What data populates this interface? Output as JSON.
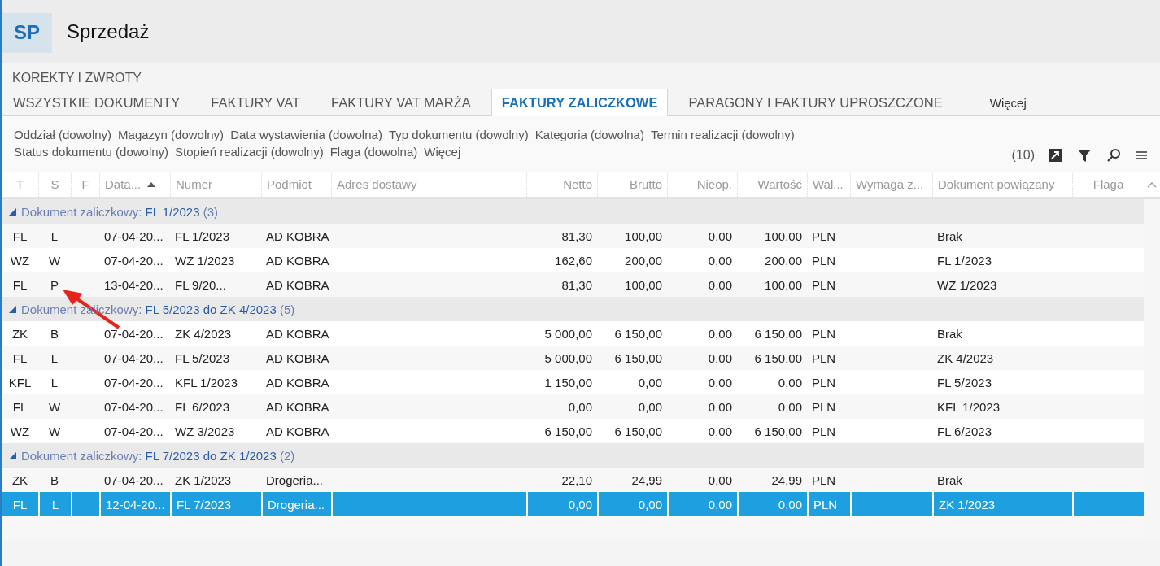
{
  "app": {
    "badge": "SP",
    "title": "Sprzedaż"
  },
  "section": "KOREKTY I ZWROTY",
  "tabs": [
    {
      "label": "WSZYSTKIE DOKUMENTY",
      "selected": false
    },
    {
      "label": "FAKTURY VAT",
      "selected": false
    },
    {
      "label": "FAKTURY VAT MARŻA",
      "selected": false
    },
    {
      "label": "FAKTURY ZALICZKOWE",
      "selected": true
    },
    {
      "label": "PARAGONY I FAKTURY UPROSZCZONE",
      "selected": false
    },
    {
      "label": "Więcej",
      "selected": false
    }
  ],
  "filters": [
    [
      "Oddział (dowolny)",
      "Magazyn (dowolny)",
      "Data wystawienia (dowolna)",
      "Typ dokumentu (dowolny)",
      "Kategoria (dowolna)",
      "Termin realizacji (dowolny)"
    ],
    [
      "Status dokumentu (dowolny)",
      "Stopień realizacji (dowolny)",
      "Flaga (dowolna)",
      "Więcej"
    ]
  ],
  "count": "(10)",
  "table": {
    "columns": [
      {
        "label": "T"
      },
      {
        "label": "S"
      },
      {
        "label": "F"
      },
      {
        "label": "Data...",
        "sorted": true
      },
      {
        "label": "Numer"
      },
      {
        "label": "Podmiot"
      },
      {
        "label": "Adres dostawy"
      },
      {
        "label": "Netto"
      },
      {
        "label": "Brutto"
      },
      {
        "label": "Nieop."
      },
      {
        "label": "Wartość"
      },
      {
        "label": "Wal..."
      },
      {
        "label": "Wymaga z..."
      },
      {
        "label": "Dokument powiązany"
      },
      {
        "label": "Flaga"
      }
    ],
    "groups": [
      {
        "label": "Dokument zaliczkowy:",
        "value": "FL 1/2023",
        "count": "(3)",
        "expanded": true,
        "rows": [
          {
            "cells": [
              "FL",
              "L",
              "",
              "07-04-20...",
              "FL 1/2023",
              "AD KOBRA",
              "",
              "81,30",
              "100,00",
              "0,00",
              "100,00",
              "PLN",
              "",
              "Brak",
              ""
            ],
            "selected": false
          },
          {
            "cells": [
              "WZ",
              "W",
              "",
              "07-04-20...",
              "WZ 1/2023",
              "AD KOBRA",
              "",
              "162,60",
              "200,00",
              "0,00",
              "200,00",
              "PLN",
              "",
              "FL 1/2023",
              ""
            ],
            "selected": false
          },
          {
            "cells": [
              "FL",
              "P",
              "",
              "13-04-20...",
              "FL 9/20...",
              "AD KOBRA",
              "",
              "81,30",
              "100,00",
              "0,00",
              "100,00",
              "PLN",
              "",
              "WZ 1/2023",
              ""
            ],
            "selected": false
          }
        ]
      },
      {
        "label": "Dokument zaliczkowy:",
        "value": "FL 5/2023 do ZK 4/2023",
        "count": "(5)",
        "expanded": true,
        "rows": [
          {
            "cells": [
              "ZK",
              "B",
              "",
              "07-04-20...",
              "ZK 4/2023",
              "AD KOBRA",
              "",
              "5 000,00",
              "6 150,00",
              "0,00",
              "6 150,00",
              "PLN",
              "",
              "Brak",
              ""
            ],
            "selected": false
          },
          {
            "cells": [
              "FL",
              "L",
              "",
              "07-04-20...",
              "FL 5/2023",
              "AD KOBRA",
              "",
              "5 000,00",
              "6 150,00",
              "0,00",
              "6 150,00",
              "PLN",
              "",
              "ZK 4/2023",
              ""
            ],
            "selected": false
          },
          {
            "cells": [
              "KFL",
              "L",
              "",
              "07-04-20...",
              "KFL 1/2023",
              "AD KOBRA",
              "",
              "1 150,00",
              "0,00",
              "0,00",
              "0,00",
              "PLN",
              "",
              "FL 5/2023",
              ""
            ],
            "selected": false
          },
          {
            "cells": [
              "FL",
              "W",
              "",
              "07-04-20...",
              "FL 6/2023",
              "AD KOBRA",
              "",
              "0,00",
              "0,00",
              "0,00",
              "0,00",
              "PLN",
              "",
              "KFL 1/2023",
              ""
            ],
            "selected": false
          },
          {
            "cells": [
              "WZ",
              "W",
              "",
              "07-04-20...",
              "WZ 3/2023",
              "AD KOBRA",
              "",
              "6 150,00",
              "6 150,00",
              "0,00",
              "6 150,00",
              "PLN",
              "",
              "FL 6/2023",
              ""
            ],
            "selected": false
          }
        ]
      },
      {
        "label": "Dokument zaliczkowy:",
        "value": "FL 7/2023 do ZK 1/2023",
        "count": "(2)",
        "expanded": true,
        "rows": [
          {
            "cells": [
              "ZK",
              "B",
              "",
              "07-04-20...",
              "ZK 1/2023",
              "Drogeria...",
              "",
              "22,10",
              "24,99",
              "0,00",
              "24,99",
              "PLN",
              "",
              "Brak",
              ""
            ],
            "selected": false
          },
          {
            "cells": [
              "FL",
              "L",
              "",
              "12-04-20...",
              "FL 7/2023",
              "Drogeria...",
              "",
              "0,00",
              "0,00",
              "0,00",
              "0,00",
              "PLN",
              "",
              "ZK 1/2023",
              ""
            ],
            "selected": true
          }
        ]
      }
    ]
  }
}
